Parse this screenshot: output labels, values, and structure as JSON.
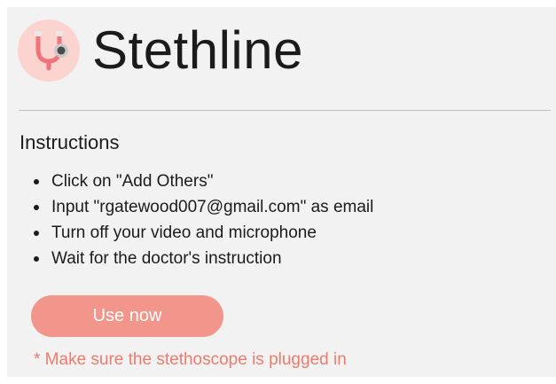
{
  "header": {
    "app_name": "Stethline",
    "logo_icon": "stethoscope-icon"
  },
  "instructions": {
    "title": "Instructions",
    "items": [
      "Click on \"Add Others\"",
      "Input \"rgatewood007@gmail.com\" as email",
      "Turn off your video and microphone",
      "Wait for the doctor's instruction"
    ]
  },
  "action": {
    "button_label": "Use now"
  },
  "note": "* Make sure the stethoscope is plugged in",
  "colors": {
    "accent": "#f2958a",
    "note": "#ee7b6c",
    "logo_bg": "#fbd3cf"
  }
}
